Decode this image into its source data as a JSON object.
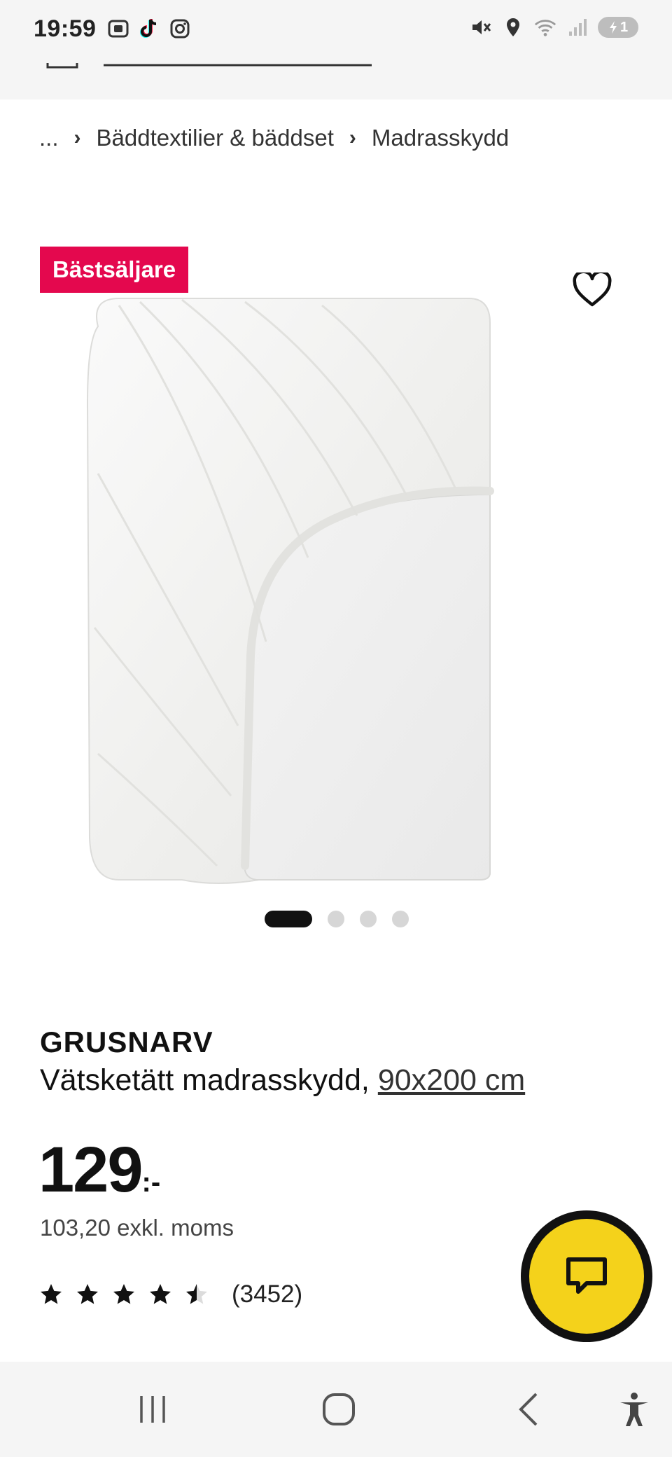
{
  "status_bar": {
    "time": "19:59",
    "battery_level": "1",
    "left_icons": [
      "screenshot-icon",
      "tiktok-icon",
      "instagram-icon"
    ],
    "right_icons": [
      "mute-icon",
      "location-icon",
      "wifi-icon",
      "signal-icon",
      "battery-icon"
    ]
  },
  "breadcrumb": {
    "ellipsis": "...",
    "items": [
      {
        "label": "Bäddtextilier & bäddset"
      },
      {
        "label": "Madrasskydd"
      }
    ]
  },
  "product": {
    "badge": "Bästsäljare",
    "name": "GRUSNARV",
    "description": "Vätsketätt madrasskydd,",
    "size": "90x200 cm",
    "price": "129",
    "price_suffix": ":-",
    "price_excl_vat": "103,20 exkl. moms",
    "rating_value": 4.5,
    "rating_max": 5,
    "review_count": "(3452)"
  },
  "carousel": {
    "total": 4,
    "active_index": 0
  },
  "colors": {
    "badge": "#e4084e",
    "chat_button": "#f4d21b",
    "status_bar_bg": "#f5f5f5"
  },
  "nav": {
    "icons": [
      "recent-apps-icon",
      "home-icon",
      "back-icon",
      "accessibility-icon"
    ]
  }
}
